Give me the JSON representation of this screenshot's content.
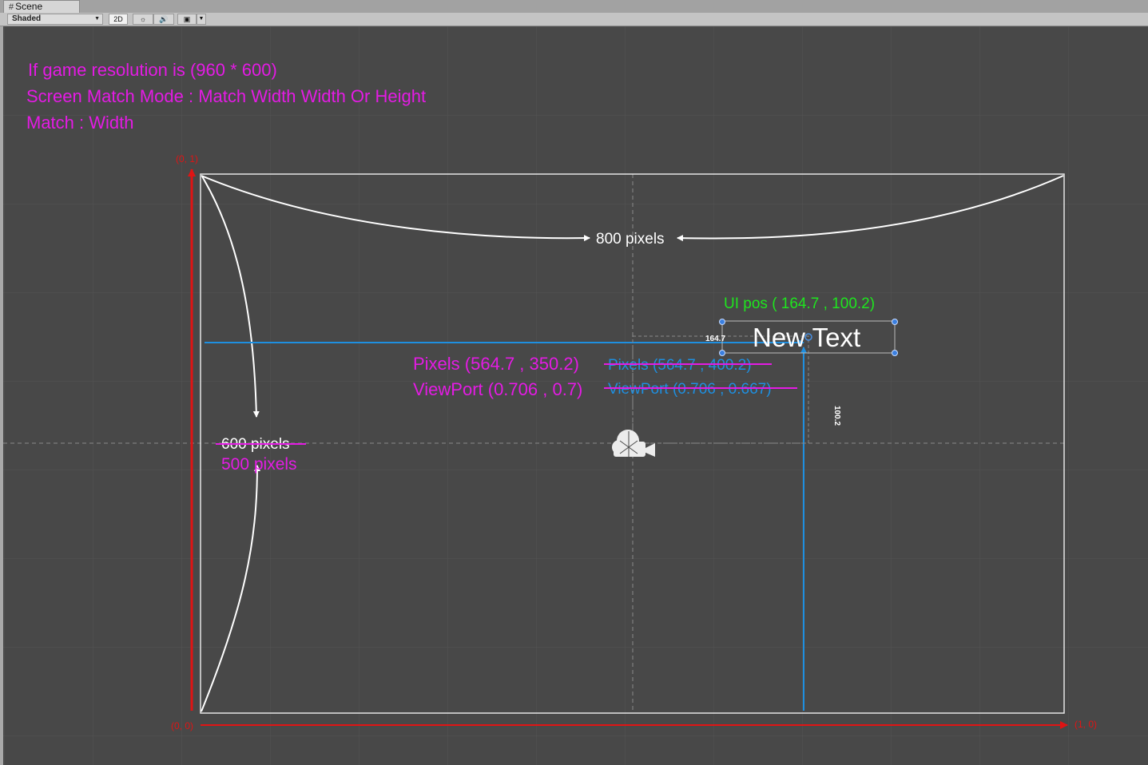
{
  "window": {
    "tab_label": "Scene",
    "tab_icon": "grid-icon"
  },
  "toolbar": {
    "draw_mode": "Shaded",
    "mode_2d": "2D",
    "lighting_icon": "sun-icon",
    "audio_icon": "speaker-icon",
    "effects_icon": "image-icon"
  },
  "notes": {
    "line1": "If game resolution is (960 * 600)",
    "line2": "Screen Match Mode : Match Width Width Or Height",
    "line3": "Match : Width"
  },
  "canvas": {
    "corner_top_left": "(0, 1)",
    "corner_bottom_left": "(0, 0)",
    "corner_bottom_right": "(1, 0)",
    "width_label": "800 pixels",
    "height_label_old": "600 pixels",
    "height_label_new": "500 pixels"
  },
  "ui_element": {
    "text": "New Text",
    "pos_label": "UI pos ( 164.7 , 100.2)",
    "x_measure": "164.7",
    "y_measure": "100.2"
  },
  "annotations": {
    "pixels_new": "Pixels (564.7 , 350.2)",
    "viewport_new": "ViewPort (0.706 , 0.7)",
    "pixels_old": "Pixels (564.7 , 400.2)",
    "viewport_old": "ViewPort (0.706 , 0.667)"
  },
  "colors": {
    "magenta": "#e41be4",
    "green": "#1ee61e",
    "blue": "#1e8fe0",
    "red": "#e01414",
    "background": "#484848"
  },
  "scene_icons": {
    "camera": "camera-icon"
  }
}
